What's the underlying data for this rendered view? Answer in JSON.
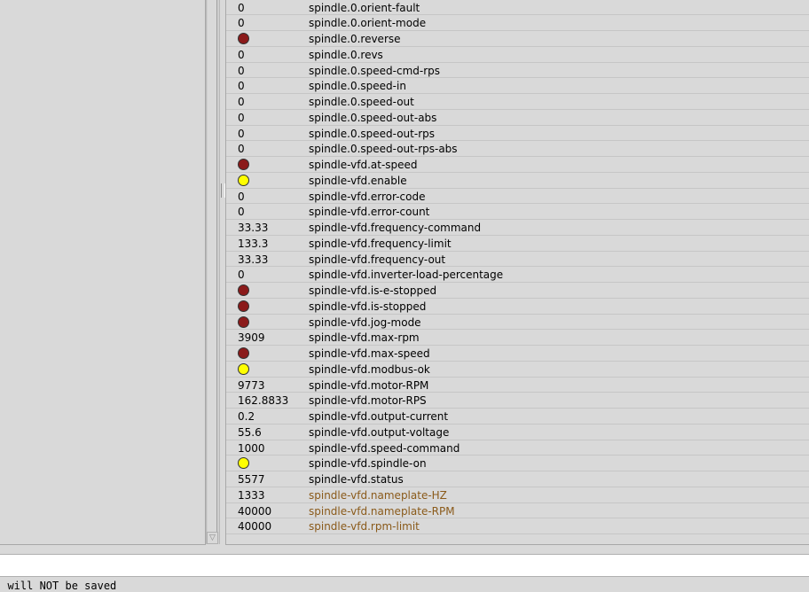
{
  "rows": [
    {
      "value": "0",
      "led": null,
      "name": "spindle.0.orient-fault",
      "kind": "pin"
    },
    {
      "value": "0",
      "led": null,
      "name": "spindle.0.orient-mode",
      "kind": "pin"
    },
    {
      "value": "",
      "led": "off",
      "name": "spindle.0.reverse",
      "kind": "pin"
    },
    {
      "value": "0",
      "led": null,
      "name": "spindle.0.revs",
      "kind": "pin"
    },
    {
      "value": "0",
      "led": null,
      "name": "spindle.0.speed-cmd-rps",
      "kind": "pin"
    },
    {
      "value": "0",
      "led": null,
      "name": "spindle.0.speed-in",
      "kind": "pin"
    },
    {
      "value": "0",
      "led": null,
      "name": "spindle.0.speed-out",
      "kind": "pin"
    },
    {
      "value": "0",
      "led": null,
      "name": "spindle.0.speed-out-abs",
      "kind": "pin"
    },
    {
      "value": "0",
      "led": null,
      "name": "spindle.0.speed-out-rps",
      "kind": "pin"
    },
    {
      "value": "0",
      "led": null,
      "name": "spindle.0.speed-out-rps-abs",
      "kind": "pin"
    },
    {
      "value": "",
      "led": "off",
      "name": "spindle-vfd.at-speed",
      "kind": "pin"
    },
    {
      "value": "",
      "led": "on",
      "name": "spindle-vfd.enable",
      "kind": "pin"
    },
    {
      "value": "0",
      "led": null,
      "name": "spindle-vfd.error-code",
      "kind": "pin"
    },
    {
      "value": "0",
      "led": null,
      "name": "spindle-vfd.error-count",
      "kind": "pin"
    },
    {
      "value": "33.33",
      "led": null,
      "name": "spindle-vfd.frequency-command",
      "kind": "pin"
    },
    {
      "value": "133.3",
      "led": null,
      "name": "spindle-vfd.frequency-limit",
      "kind": "pin"
    },
    {
      "value": "33.33",
      "led": null,
      "name": "spindle-vfd.frequency-out",
      "kind": "pin"
    },
    {
      "value": "0",
      "led": null,
      "name": "spindle-vfd.inverter-load-percentage",
      "kind": "pin"
    },
    {
      "value": "",
      "led": "off",
      "name": "spindle-vfd.is-e-stopped",
      "kind": "pin"
    },
    {
      "value": "",
      "led": "off",
      "name": "spindle-vfd.is-stopped",
      "kind": "pin"
    },
    {
      "value": "",
      "led": "off",
      "name": "spindle-vfd.jog-mode",
      "kind": "pin"
    },
    {
      "value": "3909",
      "led": null,
      "name": "spindle-vfd.max-rpm",
      "kind": "pin"
    },
    {
      "value": "",
      "led": "off",
      "name": "spindle-vfd.max-speed",
      "kind": "pin"
    },
    {
      "value": "",
      "led": "on",
      "name": "spindle-vfd.modbus-ok",
      "kind": "pin"
    },
    {
      "value": "9773",
      "led": null,
      "name": "spindle-vfd.motor-RPM",
      "kind": "pin"
    },
    {
      "value": "162.8833",
      "led": null,
      "name": "spindle-vfd.motor-RPS",
      "kind": "pin"
    },
    {
      "value": "0.2",
      "led": null,
      "name": "spindle-vfd.output-current",
      "kind": "pin"
    },
    {
      "value": "55.6",
      "led": null,
      "name": "spindle-vfd.output-voltage",
      "kind": "pin"
    },
    {
      "value": "1000",
      "led": null,
      "name": "spindle-vfd.speed-command",
      "kind": "pin"
    },
    {
      "value": "",
      "led": "on",
      "name": "spindle-vfd.spindle-on",
      "kind": "pin"
    },
    {
      "value": "5577",
      "led": null,
      "name": "spindle-vfd.status",
      "kind": "pin"
    },
    {
      "value": "1333",
      "led": null,
      "name": "spindle-vfd.nameplate-HZ",
      "kind": "param"
    },
    {
      "value": "40000",
      "led": null,
      "name": "spindle-vfd.nameplate-RPM",
      "kind": "param"
    },
    {
      "value": "40000",
      "led": null,
      "name": "spindle-vfd.rpm-limit",
      "kind": "param"
    }
  ],
  "status_bar": {
    "text": ""
  },
  "footer": {
    "text": ": will NOT be saved"
  },
  "colors": {
    "led_on": "#ffff00",
    "led_off": "#8b1a1a",
    "param_text": "#8a5a1a"
  },
  "icons": {
    "scroll_down": "triangle-down"
  }
}
